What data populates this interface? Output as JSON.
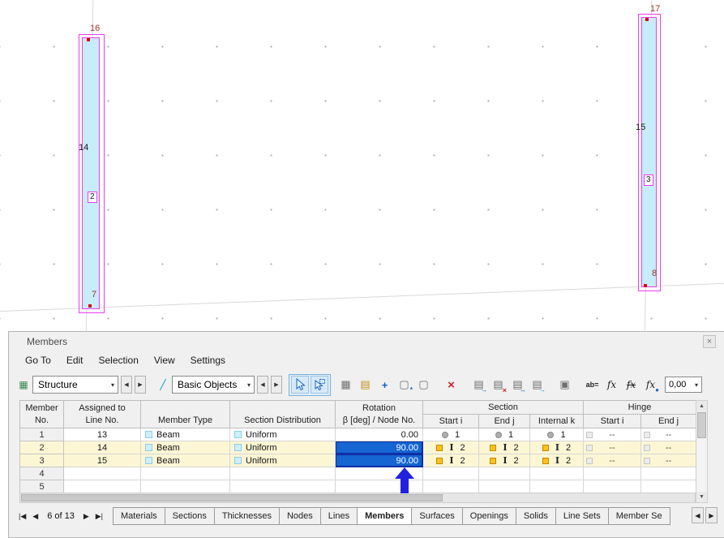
{
  "colors": {
    "member_fill": "#c7ecfa",
    "selection_magenta": "#f03cf0",
    "node_red": "#dd0000",
    "selected_cell_blue": "#1565d3",
    "highlight_row_yellow": "#fcf6d4",
    "section_orange": "#ffc020",
    "annotation_arrow_blue": "#2121df"
  },
  "viewport": {
    "members": [
      {
        "member_no": "2",
        "line_no": "14",
        "top_node": "16",
        "bottom_node": "7"
      },
      {
        "member_no": "3",
        "line_no": "15",
        "top_node": "17",
        "bottom_node": "8"
      }
    ]
  },
  "panel": {
    "title": "Members",
    "menu_items": [
      "Go To",
      "Edit",
      "Selection",
      "View",
      "Settings"
    ],
    "toolbar": {
      "structure_select": "Structure",
      "objects_select": "Basic Objects",
      "rename_label": "ab=",
      "formula_label": "fx",
      "value_field": "0,00"
    },
    "table": {
      "headers": {
        "member_line1": "Member",
        "member_line2": "No.",
        "assigned_line1": "Assigned to",
        "assigned_line2": "Line No.",
        "member_type": "Member Type",
        "section_distribution": "Section Distribution",
        "rotation_line1": "Rotation",
        "rotation_line2": "β [deg] / Node No.",
        "section_group": "Section",
        "section_start": "Start i",
        "section_end": "End j",
        "section_internal": "Internal k",
        "hinge_group": "Hinge",
        "hinge_start": "Start i",
        "hinge_end": "End j"
      },
      "rows": [
        {
          "no": "1",
          "line": "13",
          "type": "Beam",
          "dist": "Uniform",
          "rotation": "0.00",
          "start_i": "1",
          "end_j": "1",
          "internal_k": "1",
          "hinge_start": "--",
          "hinge_end": "--"
        },
        {
          "no": "2",
          "line": "14",
          "type": "Beam",
          "dist": "Uniform",
          "rotation": "90.00",
          "start_i": "2",
          "end_j": "2",
          "internal_k": "2",
          "hinge_start": "--",
          "hinge_end": "--"
        },
        {
          "no": "3",
          "line": "15",
          "type": "Beam",
          "dist": "Uniform",
          "rotation": "90.00",
          "start_i": "2",
          "end_j": "2",
          "internal_k": "2",
          "hinge_start": "--",
          "hinge_end": "--"
        },
        {
          "no": "4"
        },
        {
          "no": "5"
        }
      ]
    },
    "bottom": {
      "nav_first": "|◀",
      "nav_prev": "◀",
      "nav_position": "6 of 13",
      "nav_next": "▶",
      "nav_last": "▶|",
      "tabs": [
        "Materials",
        "Sections",
        "Thicknesses",
        "Nodes",
        "Lines",
        "Members",
        "Surfaces",
        "Openings",
        "Solids",
        "Line Sets",
        "Member Se"
      ],
      "active_tab": "Members"
    }
  },
  "icons": {
    "close": "×",
    "caret": "▾",
    "left": "◀",
    "right": "▶",
    "up": "▲",
    "down": "▼",
    "structure": "▦",
    "objects": "╱",
    "table": "▦",
    "table_alt": "▤",
    "plus": "+",
    "star": "*",
    "window": "▢",
    "window_panel": "▣",
    "delete": "×",
    "arrow_right": "→",
    "arrow_swap": "↔",
    "ibeam": "I"
  }
}
